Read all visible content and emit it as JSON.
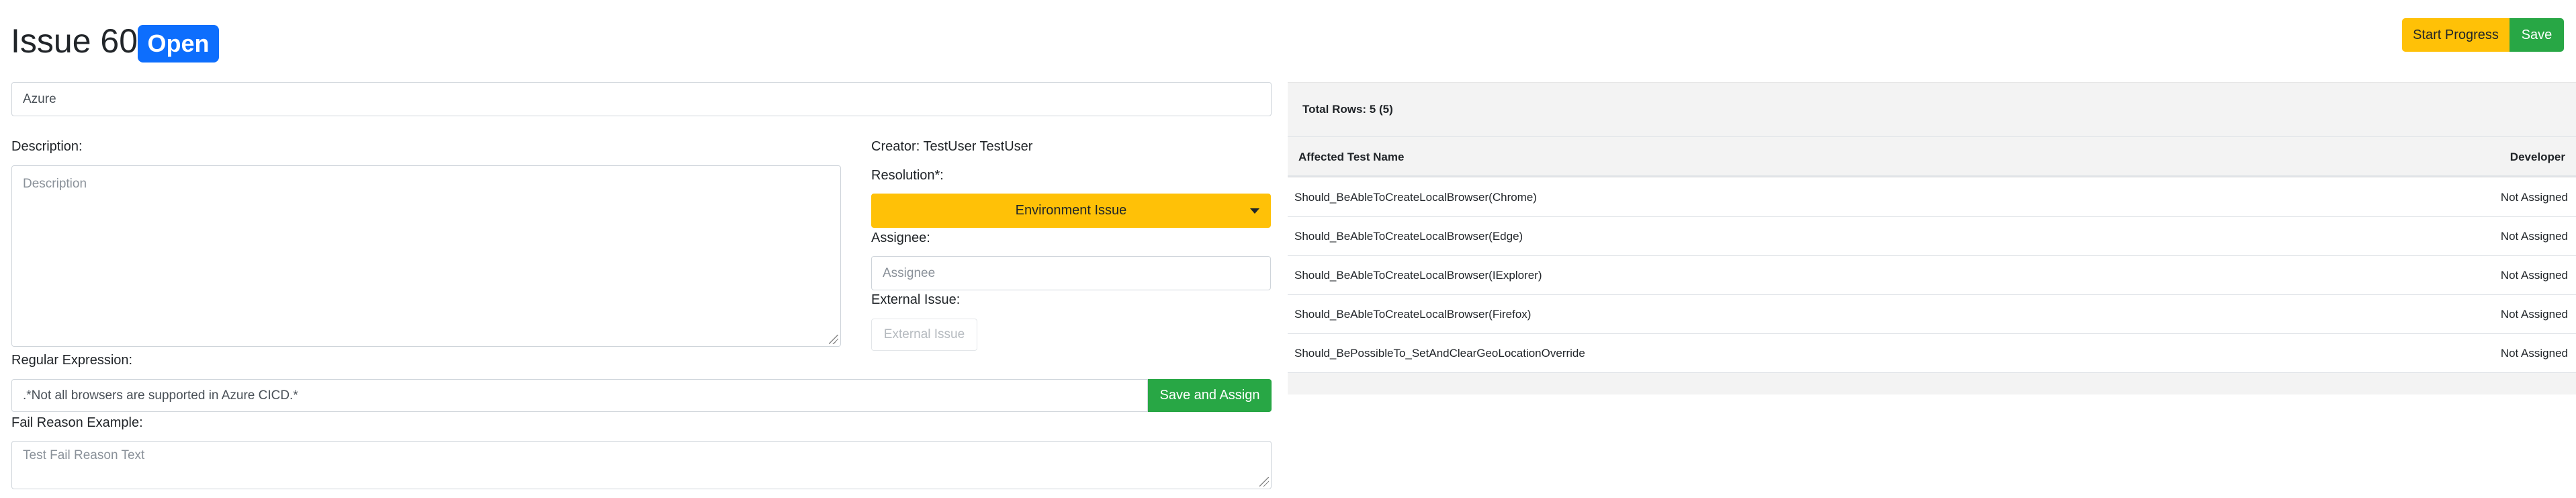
{
  "header": {
    "title": "Issue 60",
    "status_badge": "Open",
    "start_progress_label": "Start Progress",
    "save_label": "Save"
  },
  "form": {
    "name_value": "Azure",
    "description_label": "Description:",
    "description_placeholder": "Description",
    "creator_text": "Creator: TestUser TestUser",
    "resolution_label": "Resolution*:",
    "resolution_value": "Environment Issue",
    "assignee_label": "Assignee:",
    "assignee_placeholder": "Assignee",
    "external_issue_label": "External Issue:",
    "external_issue_placeholder": "External Issue",
    "regex_label": "Regular Expression:",
    "regex_value": ".*Not all browsers are supported in Azure CICD.*",
    "save_and_assign_label": "Save and Assign",
    "fail_reason_label": "Fail Reason Example:",
    "fail_reason_placeholder": "Test Fail Reason Text"
  },
  "table": {
    "total_rows": "Total Rows: 5 (5)",
    "columns": [
      "Affected Test Name",
      "Developer"
    ],
    "rows": [
      {
        "name": "Should_BeAbleToCreateLocalBrowser(Chrome)",
        "developer": "Not Assigned"
      },
      {
        "name": "Should_BeAbleToCreateLocalBrowser(Edge)",
        "developer": "Not Assigned"
      },
      {
        "name": "Should_BeAbleToCreateLocalBrowser(IExplorer)",
        "developer": "Not Assigned"
      },
      {
        "name": "Should_BeAbleToCreateLocalBrowser(Firefox)",
        "developer": "Not Assigned"
      },
      {
        "name": "Should_BePossibleTo_SetAndClearGeoLocationOverride",
        "developer": "Not Assigned"
      }
    ]
  },
  "colors": {
    "primary": "#0d6efd",
    "warning": "#ffc107",
    "success": "#28a745",
    "panel_bg": "#f3f3f3"
  }
}
